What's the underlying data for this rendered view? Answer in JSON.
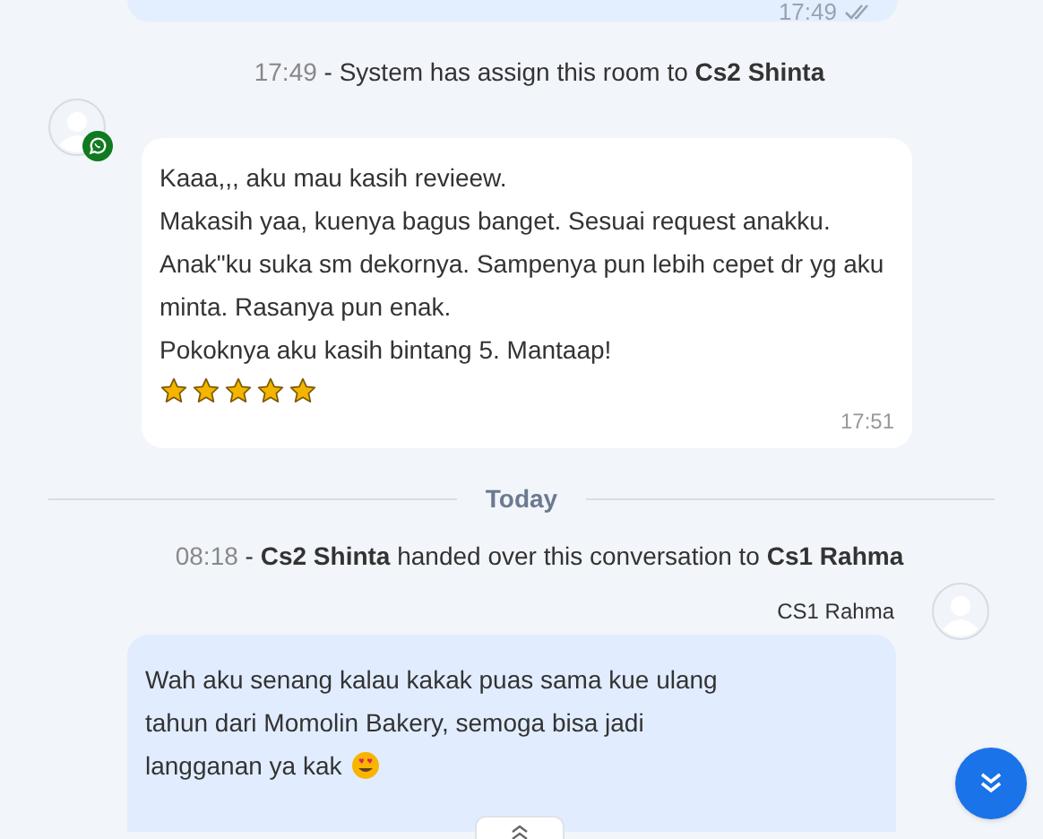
{
  "previous_message": {
    "time": "17:49",
    "read": true
  },
  "system_events": [
    {
      "time": "17:49",
      "text": "- System has assign this room to **Cs2 Shinta**"
    }
  ],
  "incoming_message": {
    "lines": [
      "Kaaa,,, aku mau kasih revieew.",
      "Makasih yaa, kuenya bagus banget. Sesuai request anakku.",
      "Anak\"ku suka sm dekornya. Sampenya pun lebih cepet dr yg aku minta. Rasanya pun enak.",
      "Pokoknya aku kasih bintang 5. Mantaap!"
    ],
    "stars": 5,
    "time": "17:51"
  },
  "date_divider": "Today",
  "handover_event": {
    "time": "08:18",
    "text": "- **Cs2 Shinta** handed over this conversation to **Cs1 Rahma**"
  },
  "outgoing_message": {
    "sender": "CS1 Rahma",
    "text": "Wah aku senang kalau kakak puas sama kue ulang tahun dari Momolin Bakery, semoga bisa jadi langganan ya kak"
  }
}
